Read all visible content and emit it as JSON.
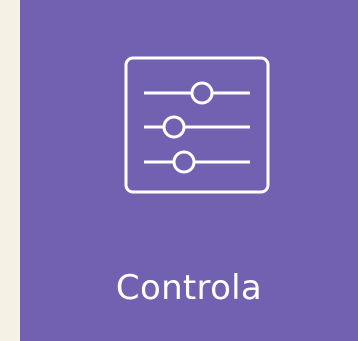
{
  "tile": {
    "label": "Controla",
    "icon": "sliders-icon",
    "background_color": "#7261b0",
    "foreground_color": "#ffffff"
  },
  "page": {
    "background_color": "#f5f1e4"
  }
}
